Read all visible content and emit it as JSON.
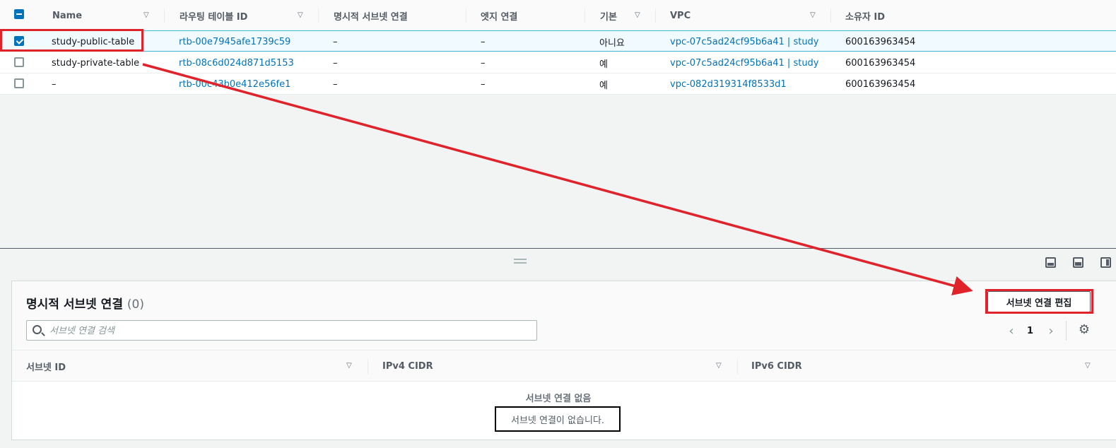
{
  "top_table": {
    "columns": [
      {
        "label": "Name"
      },
      {
        "label": "라우팅 테이블 ID"
      },
      {
        "label": "명시적 서브넷 연결"
      },
      {
        "label": "엣지 연결"
      },
      {
        "label": "기본"
      },
      {
        "label": "VPC"
      },
      {
        "label": "소유자 ID"
      }
    ],
    "rows": [
      {
        "name": "study-public-table",
        "id": "rtb-00e7945afe1739c59",
        "explicit": "–",
        "edge": "–",
        "main": "아니요",
        "vpc": "vpc-07c5ad24cf95b6a41 | study",
        "owner": "600163963454",
        "selected": true
      },
      {
        "name": "study-private-table",
        "id": "rtb-08c6d024d871d5153",
        "explicit": "–",
        "edge": "–",
        "main": "예",
        "vpc": "vpc-07c5ad24cf95b6a41 | study",
        "owner": "600163963454",
        "selected": false
      },
      {
        "name": "–",
        "id": "rtb-00c43b0e412e56fe1",
        "explicit": "–",
        "edge": "–",
        "main": "예",
        "vpc": "vpc-082d319314f8533d1",
        "owner": "600163963454",
        "selected": false
      }
    ]
  },
  "panel": {
    "title": "명시적 서브넷 연결",
    "count": "(0)",
    "edit_button": "서브넷 연결 편집",
    "search_placeholder": "서브넷 연결 검색",
    "page": "1",
    "columns": [
      {
        "label": "서브넷 ID"
      },
      {
        "label": "IPv4 CIDR"
      },
      {
        "label": "IPv6 CIDR"
      }
    ],
    "empty_title": "서브넷 연결 없음",
    "empty_desc": "서브넷 연결이 없습니다."
  },
  "icons": {
    "sort": "sort-caret-icon",
    "search": "search-icon",
    "prev": "chevron-left-icon",
    "next": "chevron-right-icon",
    "settings": "gear-icon",
    "split": "drag-handle-icon"
  },
  "colors": {
    "link": "#0073bb",
    "selected_row_bg": "#f1faff",
    "annotation_red": "#e0222b"
  }
}
